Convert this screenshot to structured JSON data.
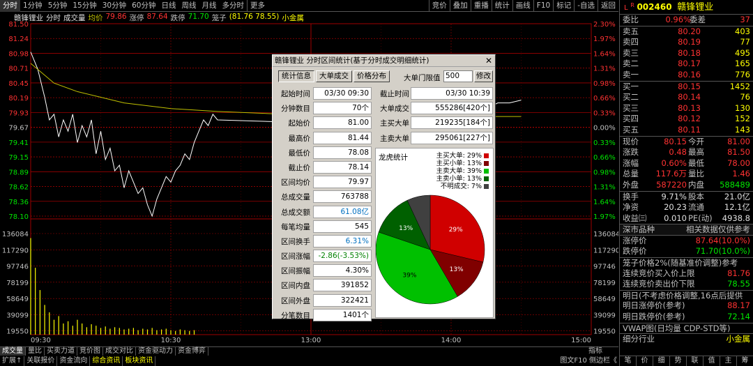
{
  "topbar": {
    "tabs": [
      "分时",
      "1分钟",
      "5分钟",
      "15分钟",
      "30分钟",
      "60分钟",
      "日线",
      "周线",
      "月线",
      "多分时",
      "更多"
    ],
    "right_buttons": [
      "竞价",
      "叠加",
      "重播",
      "统计",
      "画线",
      "F10",
      "标记",
      "-自选",
      "返回"
    ]
  },
  "legend": {
    "name": "赣锋锂业",
    "mode": "分时",
    "vol": "成交量",
    "avg_label": "均价",
    "avg": "79.86",
    "up_label": "涨停",
    "up": "87.64",
    "down_label": "跌停",
    "down": "71.70",
    "cage_label": "笼子",
    "cage": "(81.76 78.55)",
    "extra": "小金属"
  },
  "chart_data": {
    "type": "line",
    "title": "",
    "xlabel": "",
    "ylabel": "",
    "price_ticks": [
      "81.50",
      "81.24",
      "80.98",
      "80.71",
      "80.45",
      "80.19",
      "79.93",
      "79.67",
      "79.41",
      "79.15",
      "78.89",
      "78.62",
      "78.36",
      "78.10"
    ],
    "pct_ticks": [
      "2.30%",
      "1.97%",
      "1.64%",
      "1.31%",
      "0.98%",
      "0.66%",
      "0.33%",
      "0.00%",
      "0.33%",
      "0.66%",
      "0.98%",
      "1.31%",
      "1.64%",
      "1.97%"
    ],
    "vol_ticks": [
      "136084",
      "117290",
      "97746",
      "78199",
      "58649",
      "39099",
      "19550"
    ],
    "time_ticks": [
      "09:30",
      "10:30",
      "13:00",
      "14:00",
      "15:00"
    ],
    "ylim": [
      78.1,
      81.5
    ],
    "prev_close": 79.67,
    "price_series": [
      [
        0,
        81.0
      ],
      [
        3,
        80.7
      ],
      [
        6,
        80.2
      ],
      [
        8,
        79.8
      ],
      [
        10,
        79.9
      ],
      [
        12,
        79.5
      ],
      [
        14,
        79.8
      ],
      [
        16,
        79.6
      ],
      [
        18,
        79.9
      ],
      [
        20,
        79.4
      ],
      [
        22,
        79.7
      ],
      [
        24,
        79.5
      ],
      [
        26,
        79.8
      ],
      [
        28,
        79.2
      ],
      [
        30,
        79.6
      ],
      [
        32,
        79.1
      ],
      [
        34,
        79.3
      ],
      [
        36,
        78.9
      ],
      [
        38,
        79.0
      ],
      [
        40,
        78.6
      ],
      [
        42,
        78.9
      ],
      [
        44,
        78.7
      ],
      [
        46,
        78.5
      ],
      [
        48,
        78.6
      ],
      [
        50,
        78.3
      ],
      [
        52,
        78.1
      ],
      [
        54,
        78.4
      ],
      [
        56,
        78.6
      ],
      [
        58,
        78.8
      ],
      [
        60,
        78.7
      ],
      [
        62,
        78.9
      ],
      [
        64,
        79.0
      ],
      [
        66,
        79.2
      ],
      [
        68,
        79.1
      ],
      [
        70,
        79.4
      ],
      [
        72,
        79.6
      ],
      [
        74,
        79.8
      ],
      [
        76,
        79.7
      ],
      [
        78,
        79.9
      ],
      [
        80,
        79.8
      ],
      [
        160,
        79.7
      ],
      [
        165,
        79.6
      ],
      [
        170,
        79.7
      ],
      [
        175,
        79.6
      ],
      [
        180,
        79.7
      ],
      [
        185,
        79.8
      ],
      [
        190,
        79.9
      ],
      [
        195,
        80.0
      ],
      [
        200,
        80.1
      ],
      [
        205,
        80.1
      ],
      [
        210,
        80.15
      ]
    ],
    "avg_series": [
      [
        0,
        80.8
      ],
      [
        10,
        80.45
      ],
      [
        20,
        80.3
      ],
      [
        30,
        80.2
      ],
      [
        40,
        80.1
      ],
      [
        60,
        80.0
      ],
      [
        80,
        79.95
      ],
      [
        120,
        79.88
      ],
      [
        160,
        79.86
      ],
      [
        210,
        79.86
      ]
    ],
    "volume_series": [
      130000,
      90000,
      60000,
      40000,
      30000,
      20000,
      25000,
      15000,
      18000,
      12000,
      20000,
      15000,
      10000,
      14000,
      12000,
      9000,
      11000,
      8000,
      10000,
      9000,
      7000,
      8000,
      9000,
      6000,
      8000,
      7000,
      9000,
      6000,
      7000,
      8000,
      6000,
      5000,
      7000,
      6000,
      5000,
      6000
    ]
  },
  "dialog": {
    "title": "赣锋锂业 分时区间统计(基于分时成交明细统计)",
    "close": "✕",
    "tabs": [
      "统计信息",
      "大单成交",
      "价格分布"
    ],
    "threshold_label": "大单门限值",
    "threshold_value": "500",
    "modify": "修改",
    "left": [
      [
        "起始时间",
        "03/30 09:30"
      ],
      [
        "分钟数目",
        "70个"
      ],
      [
        "起始价",
        "81.00"
      ],
      [
        "最高价",
        "81.44"
      ],
      [
        "最低价",
        "78.08"
      ],
      [
        "截止价",
        "78.14"
      ],
      [
        "区间均价",
        "79.97"
      ],
      [
        "总成交量",
        "763788"
      ],
      [
        "总成交额",
        "61.08亿"
      ],
      [
        "每笔均量",
        "545"
      ],
      [
        "区间换手",
        "6.31%"
      ],
      [
        "区间涨幅",
        "-2.86(-3.53%)"
      ],
      [
        "区间振幅",
        "4.30%"
      ],
      [
        "区间内盘",
        "391852"
      ],
      [
        "区间外盘",
        "322421"
      ],
      [
        "分笔数目",
        "1401个"
      ]
    ],
    "right": [
      [
        "截止时间",
        "03/30 10:39"
      ],
      [
        "大单成交",
        "555286[420个]"
      ],
      [
        "主买大单",
        "219235[184个]"
      ],
      [
        "主卖大单",
        "295061[227个]"
      ]
    ],
    "lh_title": "龙虎统计",
    "lh_legend": [
      [
        "主买大单:",
        "29%",
        "#d00000"
      ],
      [
        "主买小单:",
        "13%",
        "#800000"
      ],
      [
        "主卖大单:",
        "39%",
        "#00c000"
      ],
      [
        "主卖小单:",
        "13%",
        "#006000"
      ],
      [
        "不明成交:",
        "7%",
        "#404040"
      ]
    ],
    "pie": [
      29,
      13,
      39,
      13,
      7
    ]
  },
  "bottom1": [
    "成交量",
    "量比",
    "买卖力道",
    "竞价图",
    "成交对比",
    "资金驱动力",
    "资金博弈"
  ],
  "bottom1_right": "指标",
  "bottom2": [
    "扩展↑",
    "关联报价",
    "资金流向",
    "综合资讯",
    "板块资讯"
  ],
  "bottom2_right": "图文F10 侧边栏《",
  "side": {
    "code": "002460",
    "name": "赣锋锂业",
    "ratio_label": "委比",
    "ratio": "0.96%",
    "diff_label": "委差",
    "diff": "37",
    "asks": [
      [
        "卖五",
        "80.20",
        "403"
      ],
      [
        "卖四",
        "80.19",
        "77"
      ],
      [
        "卖三",
        "80.18",
        "495"
      ],
      [
        "卖二",
        "80.17",
        "165"
      ],
      [
        "卖一",
        "80.16",
        "776"
      ]
    ],
    "bids": [
      [
        "买一",
        "80.15",
        "1452"
      ],
      [
        "买二",
        "80.14",
        "76"
      ],
      [
        "买三",
        "80.13",
        "130"
      ],
      [
        "买四",
        "80.12",
        "152"
      ],
      [
        "买五",
        "80.11",
        "143"
      ]
    ],
    "quote": [
      [
        "现价",
        "80.15",
        "今开",
        "81.00"
      ],
      [
        "涨跌",
        "0.48",
        "最高",
        "81.50"
      ],
      [
        "涨幅",
        "0.60%",
        "最低",
        "78.00"
      ],
      [
        "总量",
        "117.6万",
        "量比",
        "1.46"
      ],
      [
        "外盘",
        "587220",
        "内盘",
        "588489"
      ]
    ],
    "fund": [
      [
        "换手",
        "9.71%",
        "股本",
        "21.0亿"
      ],
      [
        "净资",
        "20.23",
        "流通",
        "12.1亿"
      ],
      [
        "收益㈢",
        "0.010",
        "PE(动)",
        "4938.8"
      ]
    ],
    "market": "深市品种",
    "market_ref": "相关数据仅供参考",
    "limit": [
      [
        "涨停价",
        "87.64(10.0%)"
      ],
      [
        "跌停价",
        "71.70(10.0%)"
      ]
    ],
    "cage_title": "笼子价格2%(随基准价调整)参考",
    "cage": [
      [
        "连续竞价买入价上限",
        "81.76"
      ],
      [
        "连续竞价卖出价下限",
        "78.55"
      ]
    ],
    "tomorrow_title": "明日(不考虑价格调整,16点后提供",
    "tomorrow": [
      [
        "明日涨停价(参考)",
        "88.17"
      ],
      [
        "明日跌停价(参考)",
        "72.14"
      ]
    ],
    "vwap": "VWAP图(日均量 CDP-STD等)",
    "industry_label": "细分行业",
    "industry": "小金属",
    "footer": [
      "笔",
      "价",
      "细",
      "势",
      "联",
      "值",
      "主",
      "筹"
    ]
  }
}
